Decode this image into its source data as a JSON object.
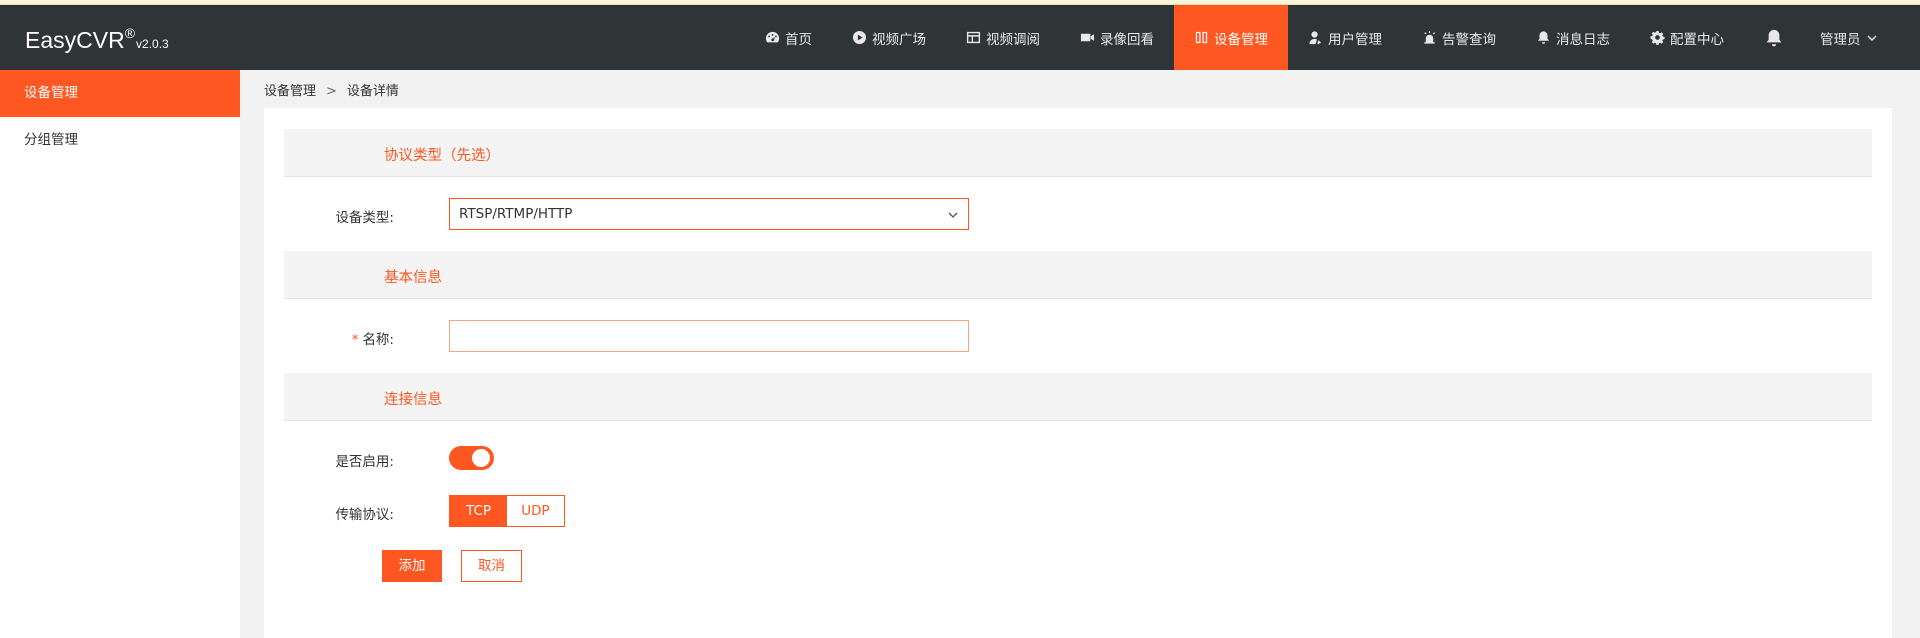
{
  "app": {
    "name": "EasyCVR",
    "registered": "®",
    "version": "v2.0.3"
  },
  "nav": {
    "items": [
      {
        "label": "首页",
        "icon": "dashboard-icon"
      },
      {
        "label": "视频广场",
        "icon": "play-circle-icon"
      },
      {
        "label": "视频调阅",
        "icon": "layout-icon"
      },
      {
        "label": "录像回看",
        "icon": "video-camera-icon"
      },
      {
        "label": "设备管理",
        "icon": "device-icon",
        "active": true
      },
      {
        "label": "用户管理",
        "icon": "user-icon"
      },
      {
        "label": "告警查询",
        "icon": "alarm-icon"
      },
      {
        "label": "消息日志",
        "icon": "bell-icon"
      },
      {
        "label": "配置中心",
        "icon": "gear-icon"
      }
    ],
    "user": "管理员"
  },
  "sidebar": {
    "items": [
      {
        "label": "设备管理",
        "active": true
      },
      {
        "label": "分组管理"
      }
    ]
  },
  "breadcrumb": {
    "parent": "设备管理",
    "separator": ">",
    "current": "设备详情"
  },
  "form": {
    "protocol_section": "协议类型（先选）",
    "device_type_label": "设备类型:",
    "device_type_value": "RTSP/RTMP/HTTP",
    "basic_section": "基本信息",
    "name_required": "*",
    "name_label": "名称:",
    "name_value": "",
    "connection_section": "连接信息",
    "enabled_label": "是否启用:",
    "enabled": true,
    "transport_label": "传输协议:",
    "transport_options": [
      "TCP",
      "UDP"
    ],
    "transport_selected": "TCP",
    "add_button": "添加",
    "cancel_button": "取消"
  },
  "colors": {
    "accent": "#ff5722",
    "header_bg": "#2f3437"
  }
}
